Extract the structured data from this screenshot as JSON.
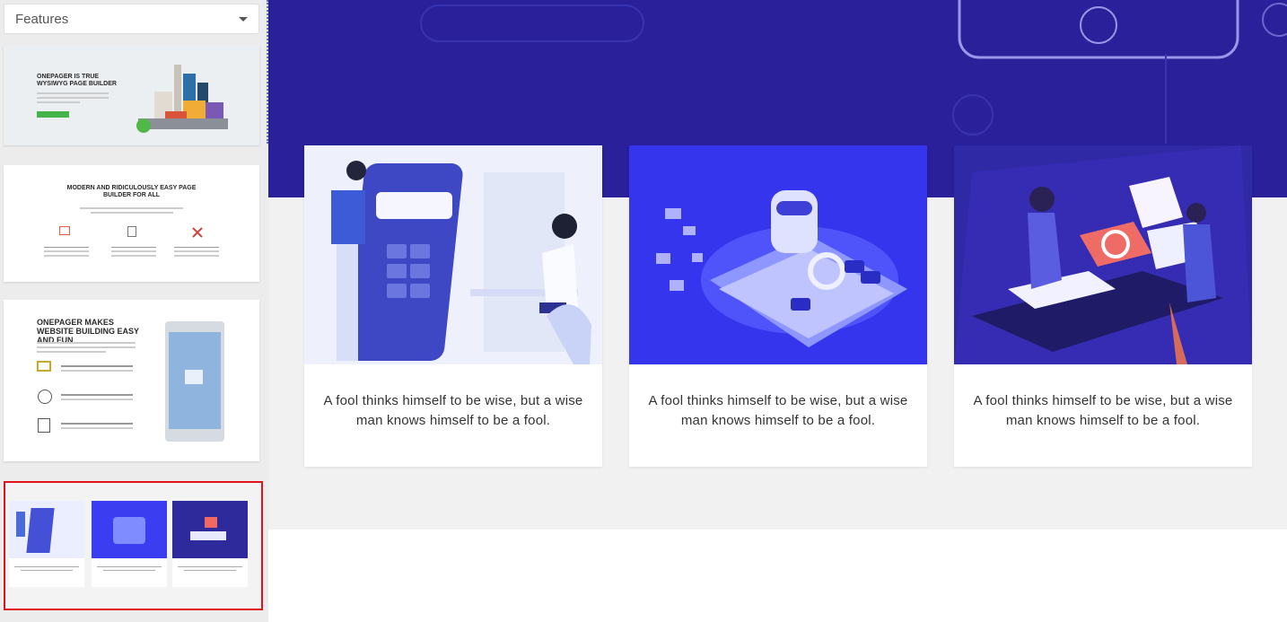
{
  "sidebar": {
    "dropdown": {
      "selected": "Features"
    },
    "thumbs": {
      "t1": {
        "title": "ONEPAGER IS TRUE WYSIWYG PAGE BUILDER"
      },
      "t2": {
        "title": "MODERN AND RIDICULOUSLY EASY PAGE BUILDER FOR ALL"
      },
      "t3": {
        "title": "ONEPAGER MAKES WEBSITE BUILDING EASY AND FUN"
      }
    }
  },
  "main": {
    "cards": [
      {
        "text": "A fool thinks himself to be wise, but a wise man knows himself to be a fool."
      },
      {
        "text": "A fool thinks himself to be wise, but a wise man knows himself to be a fool."
      },
      {
        "text": "A fool thinks himself to be wise, but a wise man knows himself to be a fool."
      }
    ]
  },
  "colors": {
    "hero_bg": "#29209a",
    "accent_blue": "#3b3ef0",
    "selection_border": "#e0121b"
  }
}
